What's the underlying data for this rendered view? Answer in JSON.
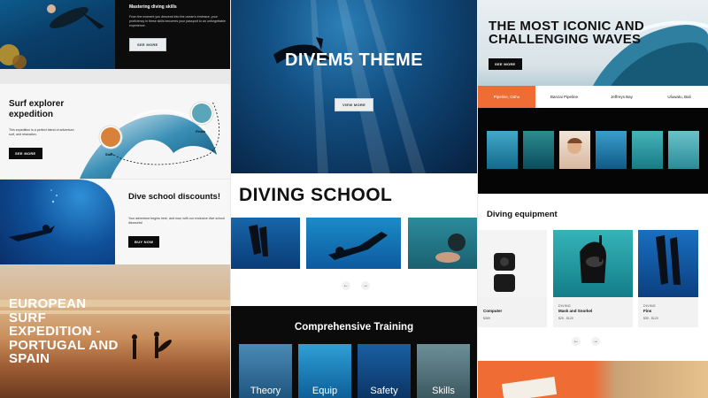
{
  "left": {
    "skills": {
      "title": "Mastering diving skills",
      "text": "From the moment you descend into the ocean's embrace, your proficiency in these skills becomes your passport to an unforgettable experience.",
      "button": "SEE MORE"
    },
    "surf": {
      "title": "Surf explorer expedition",
      "text": "This expedition is a perfect blend of adventure, surf, and relaxation.",
      "button": "SEE MORE",
      "start_label": "Start",
      "finish_label": "Finish"
    },
    "discount": {
      "title": "Dive school discounts!",
      "text": "Your adventure begins here, and now, with our exclusive dive school discounts!",
      "button": "BUY NOW"
    },
    "euro": {
      "title": "EUROPEAN SURF EXPEDITION - PORTUGAL AND SPAIN"
    }
  },
  "middle": {
    "hero": {
      "title": "DIVEM5 THEME",
      "button": "VIEW MORE"
    },
    "school": {
      "title": "DIVING SCHOOL",
      "prev": "←",
      "next": "→"
    },
    "training": {
      "title": "Comprehensive Training",
      "cards": [
        "Theory",
        "Equip",
        "Safety",
        "Skills"
      ]
    }
  },
  "right": {
    "waves": {
      "title": "THE MOST ICONIC AND CHALLENGING WAVES",
      "button": "SEE MORE",
      "tabs": [
        "Pipeline, Oahu",
        "Banzai Pipeline",
        "Jeffreys Bay",
        "Uluwatu, Bali"
      ]
    },
    "equipment": {
      "title": "Diving equipment",
      "products": [
        {
          "category": "",
          "name": "Computer",
          "price": "$369"
        },
        {
          "category": "DIVING",
          "name": "Mask and Snorkel",
          "price": "$25 - $120"
        },
        {
          "category": "DIVING",
          "name": "Fins",
          "price": "$30 - $120"
        }
      ],
      "prev": "←",
      "next": "→"
    }
  },
  "colors": {
    "accent": "#ef6c35",
    "dark": "#0b0b0b"
  }
}
